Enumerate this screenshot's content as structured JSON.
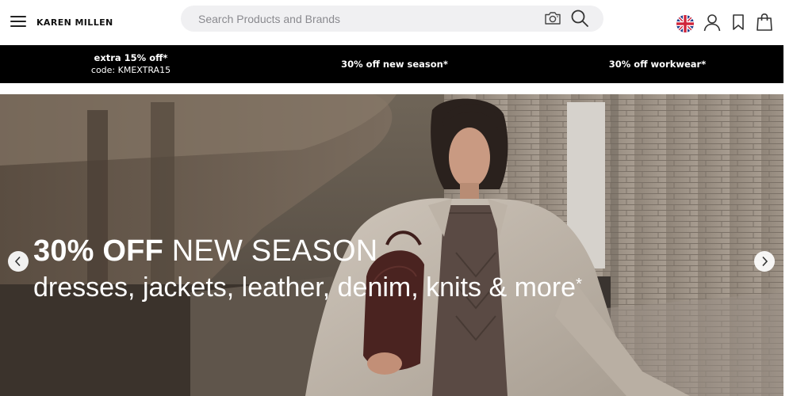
{
  "header": {
    "logo": "KAREN MILLEN",
    "search": {
      "placeholder": "Search Products and Brands"
    },
    "icons": [
      "menu-icon",
      "camera-icon",
      "search-icon",
      "uk-flag-icon",
      "account-icon",
      "bookmark-icon",
      "bag-icon"
    ]
  },
  "promo": [
    {
      "title": "extra 15% off*",
      "subtitle": "code: KMEXTRA15"
    },
    {
      "title": "30% off new season*"
    },
    {
      "title": "30% off workwear*"
    }
  ],
  "hero": {
    "headline_strong": "30% OFF",
    "headline_light": "NEW SEASON",
    "subline": "dresses, jackets, leather, denim, knits & more",
    "subline_mark": "*"
  },
  "colors": {
    "promo_bar": "#000000",
    "search_bg": "#f0f0f2",
    "hero_text": "#ffffff"
  }
}
